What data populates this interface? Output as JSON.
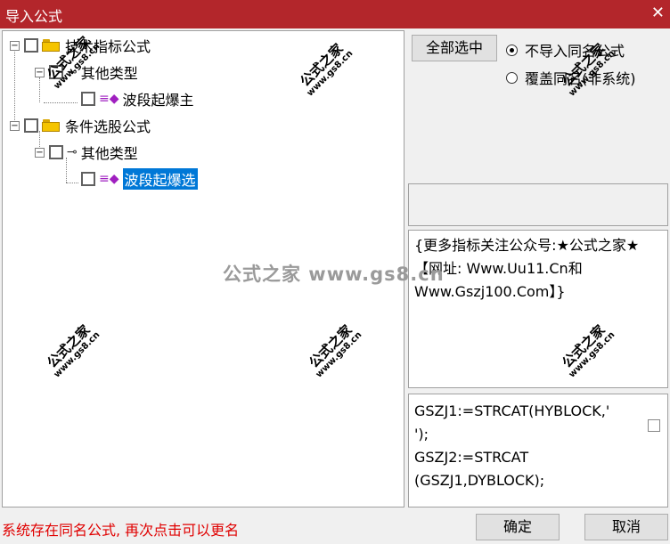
{
  "window": {
    "title": "导入公式",
    "close_glyph": "✕"
  },
  "tree": [
    {
      "label": "技术指标公式"
    },
    {
      "label": "其他类型"
    },
    {
      "label": "波段起爆主"
    },
    {
      "label": "条件选股公式"
    },
    {
      "label": "其他类型"
    },
    {
      "label": "波段起爆选",
      "selected": true
    }
  ],
  "right": {
    "select_all": "全部选中",
    "radio_no_import": "不导入同名公式",
    "radio_overwrite": "覆盖同名(非系统)",
    "info": "{更多指标关注公众号:★公式之家★ 【网址: Www.Uu11.Cn和Www.Gszj100.Com】}",
    "code": "GSZJ1:=STRCAT(HYBLOCK,'\n');\nGSZJ2:=STRCAT\n(GSZJ1,DYBLOCK);"
  },
  "status": "系统存在同名公式, 再次点击可以更名",
  "buttons": {
    "ok": "确定",
    "cancel": "取消"
  },
  "watermark": {
    "name": "公式之家",
    "site": "www.gs8.cn",
    "center": "公式之家 www.gs8.cn"
  },
  "colors": {
    "title_bar": "#b3262b",
    "selection": "#0078d7",
    "status_text": "#e00000"
  }
}
